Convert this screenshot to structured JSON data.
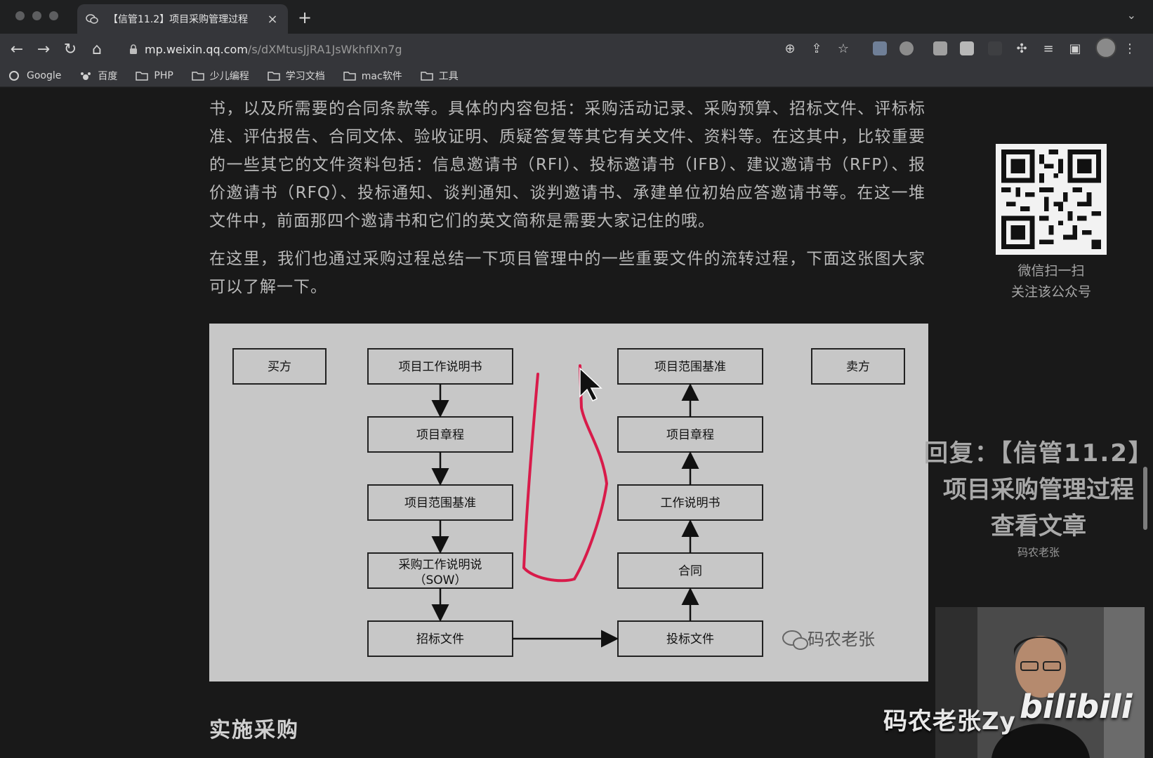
{
  "browser": {
    "tab_title": "【信管11.2】项目采购管理过程",
    "url_host": "mp.weixin.qq.com",
    "url_path": "/s/dXMtusJjRA1JsWkhfIXn7g",
    "bookmarks": [
      {
        "label": "Google"
      },
      {
        "label": "百度"
      },
      {
        "label": "PHP"
      },
      {
        "label": "少儿编程"
      },
      {
        "label": "学习文档"
      },
      {
        "label": "mac软件"
      },
      {
        "label": "工具"
      }
    ]
  },
  "article": {
    "para1": "书，以及所需要的合同条款等。具体的内容包括：采购活动记录、采购预算、招标文件、评标标准、评估报告、合同文体、验收证明、质疑答复等其它有关文件、资料等。在这其中，比较重要的一些其它的文件资料包括：信息邀请书（RFI）、投标邀请书（IFB）、建议邀请书（RFP）、报价邀请书（RFQ）、投标通知、谈判通知、谈判邀请书、承建单位初始应答邀请书等。在这一堆文件中，前面那四个邀请书和它们的英文简称是需要大家记住的哦。",
    "para2": "在这里，我们也通过采购过程总结一下项目管理中的一些重要文件的流转过程，下面这张图大家可以了解一下。",
    "section_title": "实施采购"
  },
  "diagram": {
    "buyer": "买方",
    "seller": "卖方",
    "left_boxes": [
      "项目工作说明书",
      "项目章程",
      "项目范围基准",
      "采购工作说明说",
      "（SOW）",
      "招标文件"
    ],
    "right_boxes": [
      "项目范围基准",
      "项目章程",
      "工作说明书",
      "合同",
      "投标文件"
    ],
    "watermark": "码农老张"
  },
  "sidebar": {
    "qr_caption_1": "微信扫一扫",
    "qr_caption_2": "关注该公众号"
  },
  "overlay": {
    "line1": "回复：【信管11.2】",
    "line2": "项目采购管理过程",
    "line3": "查看文章",
    "line4": "码农老张"
  },
  "video": {
    "uploader": "码农老张Zy",
    "brand": "bilibili"
  }
}
